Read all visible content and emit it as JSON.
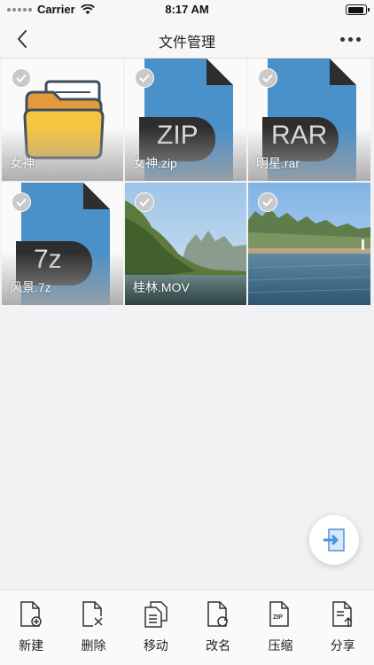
{
  "status_bar": {
    "carrier": "Carrier",
    "time": "8:17 AM"
  },
  "nav": {
    "title": "文件管理",
    "back_icon": "chevron-left-icon",
    "more_icon": "ellipsis-icon"
  },
  "files": [
    {
      "name": "女神",
      "type": "folder",
      "selected": true
    },
    {
      "name": "女神.zip",
      "type": "archive",
      "badge": "ZIP",
      "selected": true
    },
    {
      "name": "明星.rar",
      "type": "archive",
      "badge": "RAR",
      "selected": true
    },
    {
      "name": "风景.7z",
      "type": "archive",
      "badge": "7z",
      "selected": true
    },
    {
      "name": "桂林.MOV",
      "type": "video",
      "selected": true
    },
    {
      "name": "",
      "type": "image",
      "selected": true
    }
  ],
  "fab": {
    "icon": "import-icon"
  },
  "toolbar": {
    "items": [
      {
        "label": "新建",
        "icon": "new-file-icon"
      },
      {
        "label": "删除",
        "icon": "delete-file-icon"
      },
      {
        "label": "移动",
        "icon": "move-file-icon"
      },
      {
        "label": "改名",
        "icon": "rename-file-icon"
      },
      {
        "label": "压缩",
        "icon": "compress-file-icon"
      },
      {
        "label": "分享",
        "icon": "share-file-icon"
      }
    ]
  },
  "colors": {
    "archive_blue": "#4a90c9",
    "badge_dark": "#2e2e2e",
    "folder_yellow": "#f5c542",
    "folder_orange": "#e49a3a",
    "accent": "#4a90e2"
  }
}
